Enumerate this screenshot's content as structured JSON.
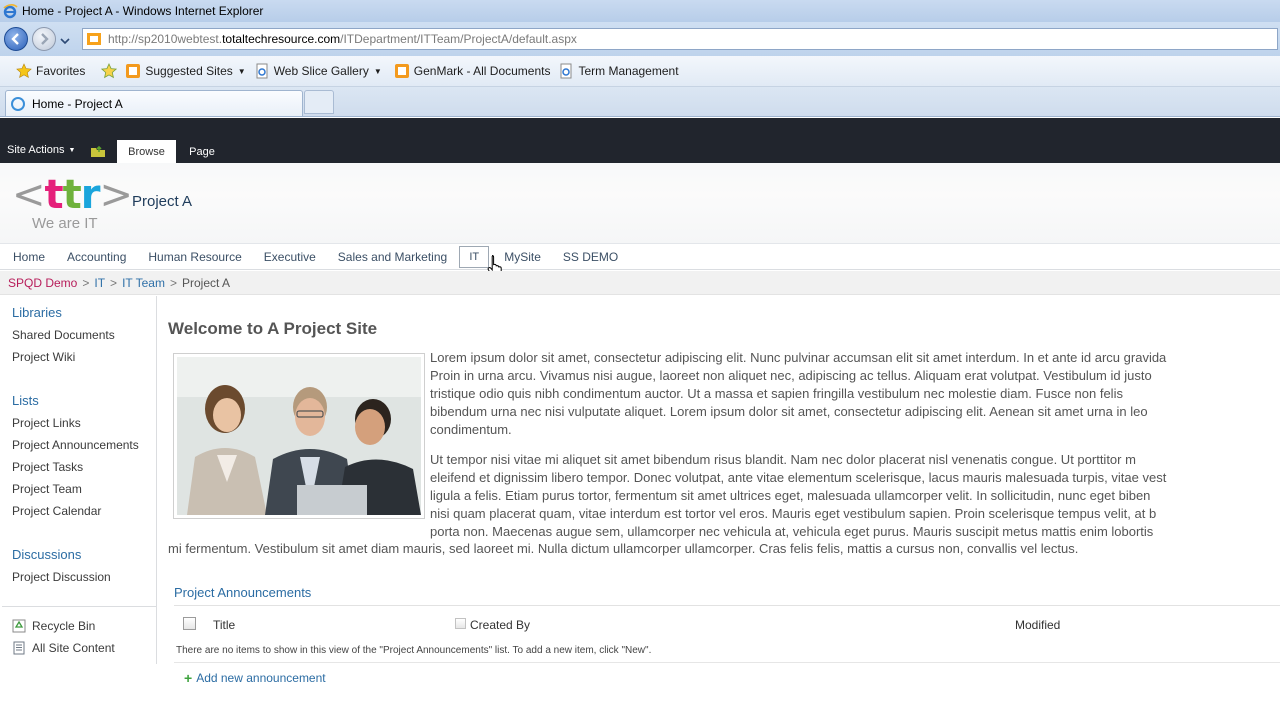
{
  "browser": {
    "window_title": "Home - Project A - Windows Internet Explorer",
    "url_prefix": "http://sp2010webtest.",
    "url_domain": "totaltechresource.com",
    "url_path": "/ITDepartment/ITTeam/ProjectA/default.aspx",
    "favorites_label": "Favorites",
    "favorites_links": [
      {
        "label": "Suggested Sites",
        "icon": "rss-feed-icon"
      },
      {
        "label": "Web Slice Gallery",
        "icon": "ie-page-icon"
      },
      {
        "label": "GenMark - All Documents",
        "icon": "sharepoint-icon"
      },
      {
        "label": "Term Management",
        "icon": "ie-page-icon"
      }
    ],
    "tab_label": "Home - Project A"
  },
  "ribbon": {
    "site_actions": "Site Actions",
    "tabs": [
      "Browse",
      "Page"
    ]
  },
  "header": {
    "logo_text": "<ttr>",
    "logo_tagline": "We are IT",
    "site_title": "Project A"
  },
  "topnav": {
    "items": [
      "Home",
      "Accounting",
      "Human Resource",
      "Executive",
      "Sales and Marketing",
      "IT",
      "MySite",
      "SS DEMO"
    ]
  },
  "breadcrumb": {
    "items": [
      "SPQD Demo",
      "IT",
      "IT Team",
      "Project A"
    ],
    "separator": ">"
  },
  "quicklaunch": {
    "libraries_heading": "Libraries",
    "libraries": [
      "Shared Documents",
      "Project Wiki"
    ],
    "lists_heading": "Lists",
    "lists": [
      "Project Links",
      "Project Announcements",
      "Project Tasks",
      "Project Team",
      "Project Calendar"
    ],
    "discussions_heading": "Discussions",
    "discussions": [
      "Project Discussion"
    ],
    "recycle_bin": "Recycle Bin",
    "all_site_content": "All Site Content"
  },
  "main": {
    "title": "Welcome to A Project Site",
    "para1_lines": [
      "Lorem ipsum dolor sit amet, consectetur adipiscing elit. Nunc pulvinar accumsan elit sit amet interdum. In et ante id arcu gravida",
      "Proin in urna arcu. Vivamus nisi augue, laoreet non aliquet nec, adipiscing ac tellus. Aliquam erat volutpat. Vestibulum id justo",
      "tristique odio quis nibh condimentum auctor. Ut a massa et sapien fringilla vestibulum nec molestie diam. Fusce non felis",
      "bibendum urna nec nisi vulputate aliquet. Lorem ipsum dolor sit amet, consectetur adipiscing elit. Aenean sit amet urna in leo",
      "condimentum."
    ],
    "para2_lines": [
      "Ut tempor nisi vitae mi aliquet sit amet bibendum risus blandit. Nam nec dolor placerat nisl venenatis congue. Ut porttitor m",
      "eleifend et dignissim libero tempor. Donec volutpat, ante vitae elementum scelerisque, lacus mauris malesuada turpis, vitae vest",
      "ligula a felis. Etiam purus tortor, fermentum sit amet ultrices eget, malesuada ullamcorper velit. In sollicitudin, nunc eget biben",
      "nisi quam placerat quam, vitae interdum est tortor vel eros. Mauris eget vestibulum sapien. Proin scelerisque tempus velit, at b",
      "porta non. Maecenas augue sem, ullamcorper nec vehicula at, vehicula eget purus. Mauris suscipit metus mattis enim lobortis"
    ],
    "para2_tail": "mi fermentum. Vestibulum sit amet diam mauris, sed laoreet mi. Nulla dictum ullamcorper ullamcorper. Cras felis felis, mattis a cursus non, convallis vel lectus.",
    "announcements": {
      "title": "Project Announcements",
      "columns": [
        "Title",
        "Created By",
        "Modified"
      ],
      "empty_message": "There are no items to show in this view of the \"Project Announcements\" list. To add a new item, click \"New\".",
      "add_new": "Add new announcement"
    }
  },
  "colors": {
    "ribbon_bg": "#21252d",
    "link_blue": "#2b6ca3",
    "breadcrumb_root": "#b71d5a"
  }
}
